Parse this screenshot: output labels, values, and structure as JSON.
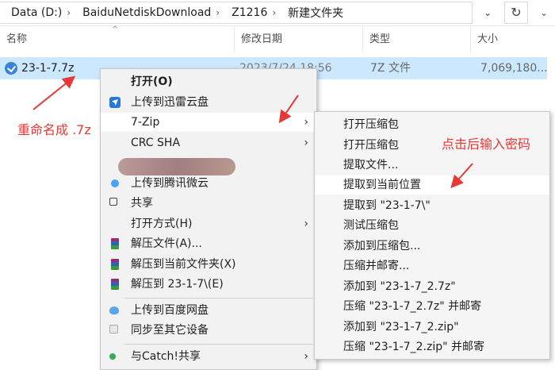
{
  "address_bar": {
    "crumbs": [
      "Data (D:)",
      "BaiduNetdiskDownload",
      "Z1216",
      "新建文件夹"
    ],
    "separator": "›",
    "dropdown_glyph": "⌄",
    "refresh_glyph": "↻",
    "more_glyph": "⌄"
  },
  "columns": {
    "name": "名称",
    "date": "修改日期",
    "type": "类型",
    "size": "大小",
    "sort_caret": "^"
  },
  "file": {
    "name": "23-1-7.7z",
    "date": "2023/7/24 18:56",
    "type": "7Z 文件",
    "size": "7,069,180..."
  },
  "context_menu": {
    "items": [
      {
        "label": "打开(O)"
      },
      {
        "label": "上传到迅雷云盘"
      },
      {
        "label": "7-Zip"
      },
      {
        "label": "CRC SHA"
      },
      {
        "label": "上传到腾讯微云"
      },
      {
        "label": "共享"
      },
      {
        "label": "打开方式(H)"
      },
      {
        "label": "解压文件(A)..."
      },
      {
        "label": "解压到当前文件夹(X)"
      },
      {
        "label": "解压到 23-1-7\\(E)"
      },
      {
        "label": "上传到百度网盘"
      },
      {
        "label": "同步至其它设备"
      },
      {
        "label": "与Catch!共享"
      }
    ],
    "submenu_arrow": "›"
  },
  "zip_submenu": {
    "items": [
      {
        "label": "打开压缩包"
      },
      {
        "label": "打开压缩包"
      },
      {
        "label": "提取文件..."
      },
      {
        "label": "提取到当前位置"
      },
      {
        "label": "提取到 \"23-1-7\\\""
      },
      {
        "label": "测试压缩包"
      },
      {
        "label": "添加到压缩包..."
      },
      {
        "label": "压缩并邮寄..."
      },
      {
        "label": "添加到 \"23-1-7_2.7z\""
      },
      {
        "label": "压缩 \"23-1-7_2.7z\" 并邮寄"
      },
      {
        "label": "添加到 \"23-1-7_2.zip\""
      },
      {
        "label": "压缩 \"23-1-7_2.zip\" 并邮寄"
      }
    ]
  },
  "annotations": {
    "rename_note": "重命名成 .7z",
    "click_note": "点击后输入密码"
  },
  "colors": {
    "selection": "#cce8ff",
    "annotation": "#e53935"
  },
  "icons": [
    "folder-refresh-icon",
    "7z-file-icon",
    "xunlei-cloud-icon",
    "tencent-weiyun-icon",
    "share-icon",
    "winrar-icon",
    "baidu-netdisk-icon",
    "sync-device-icon",
    "catch-share-icon"
  ]
}
